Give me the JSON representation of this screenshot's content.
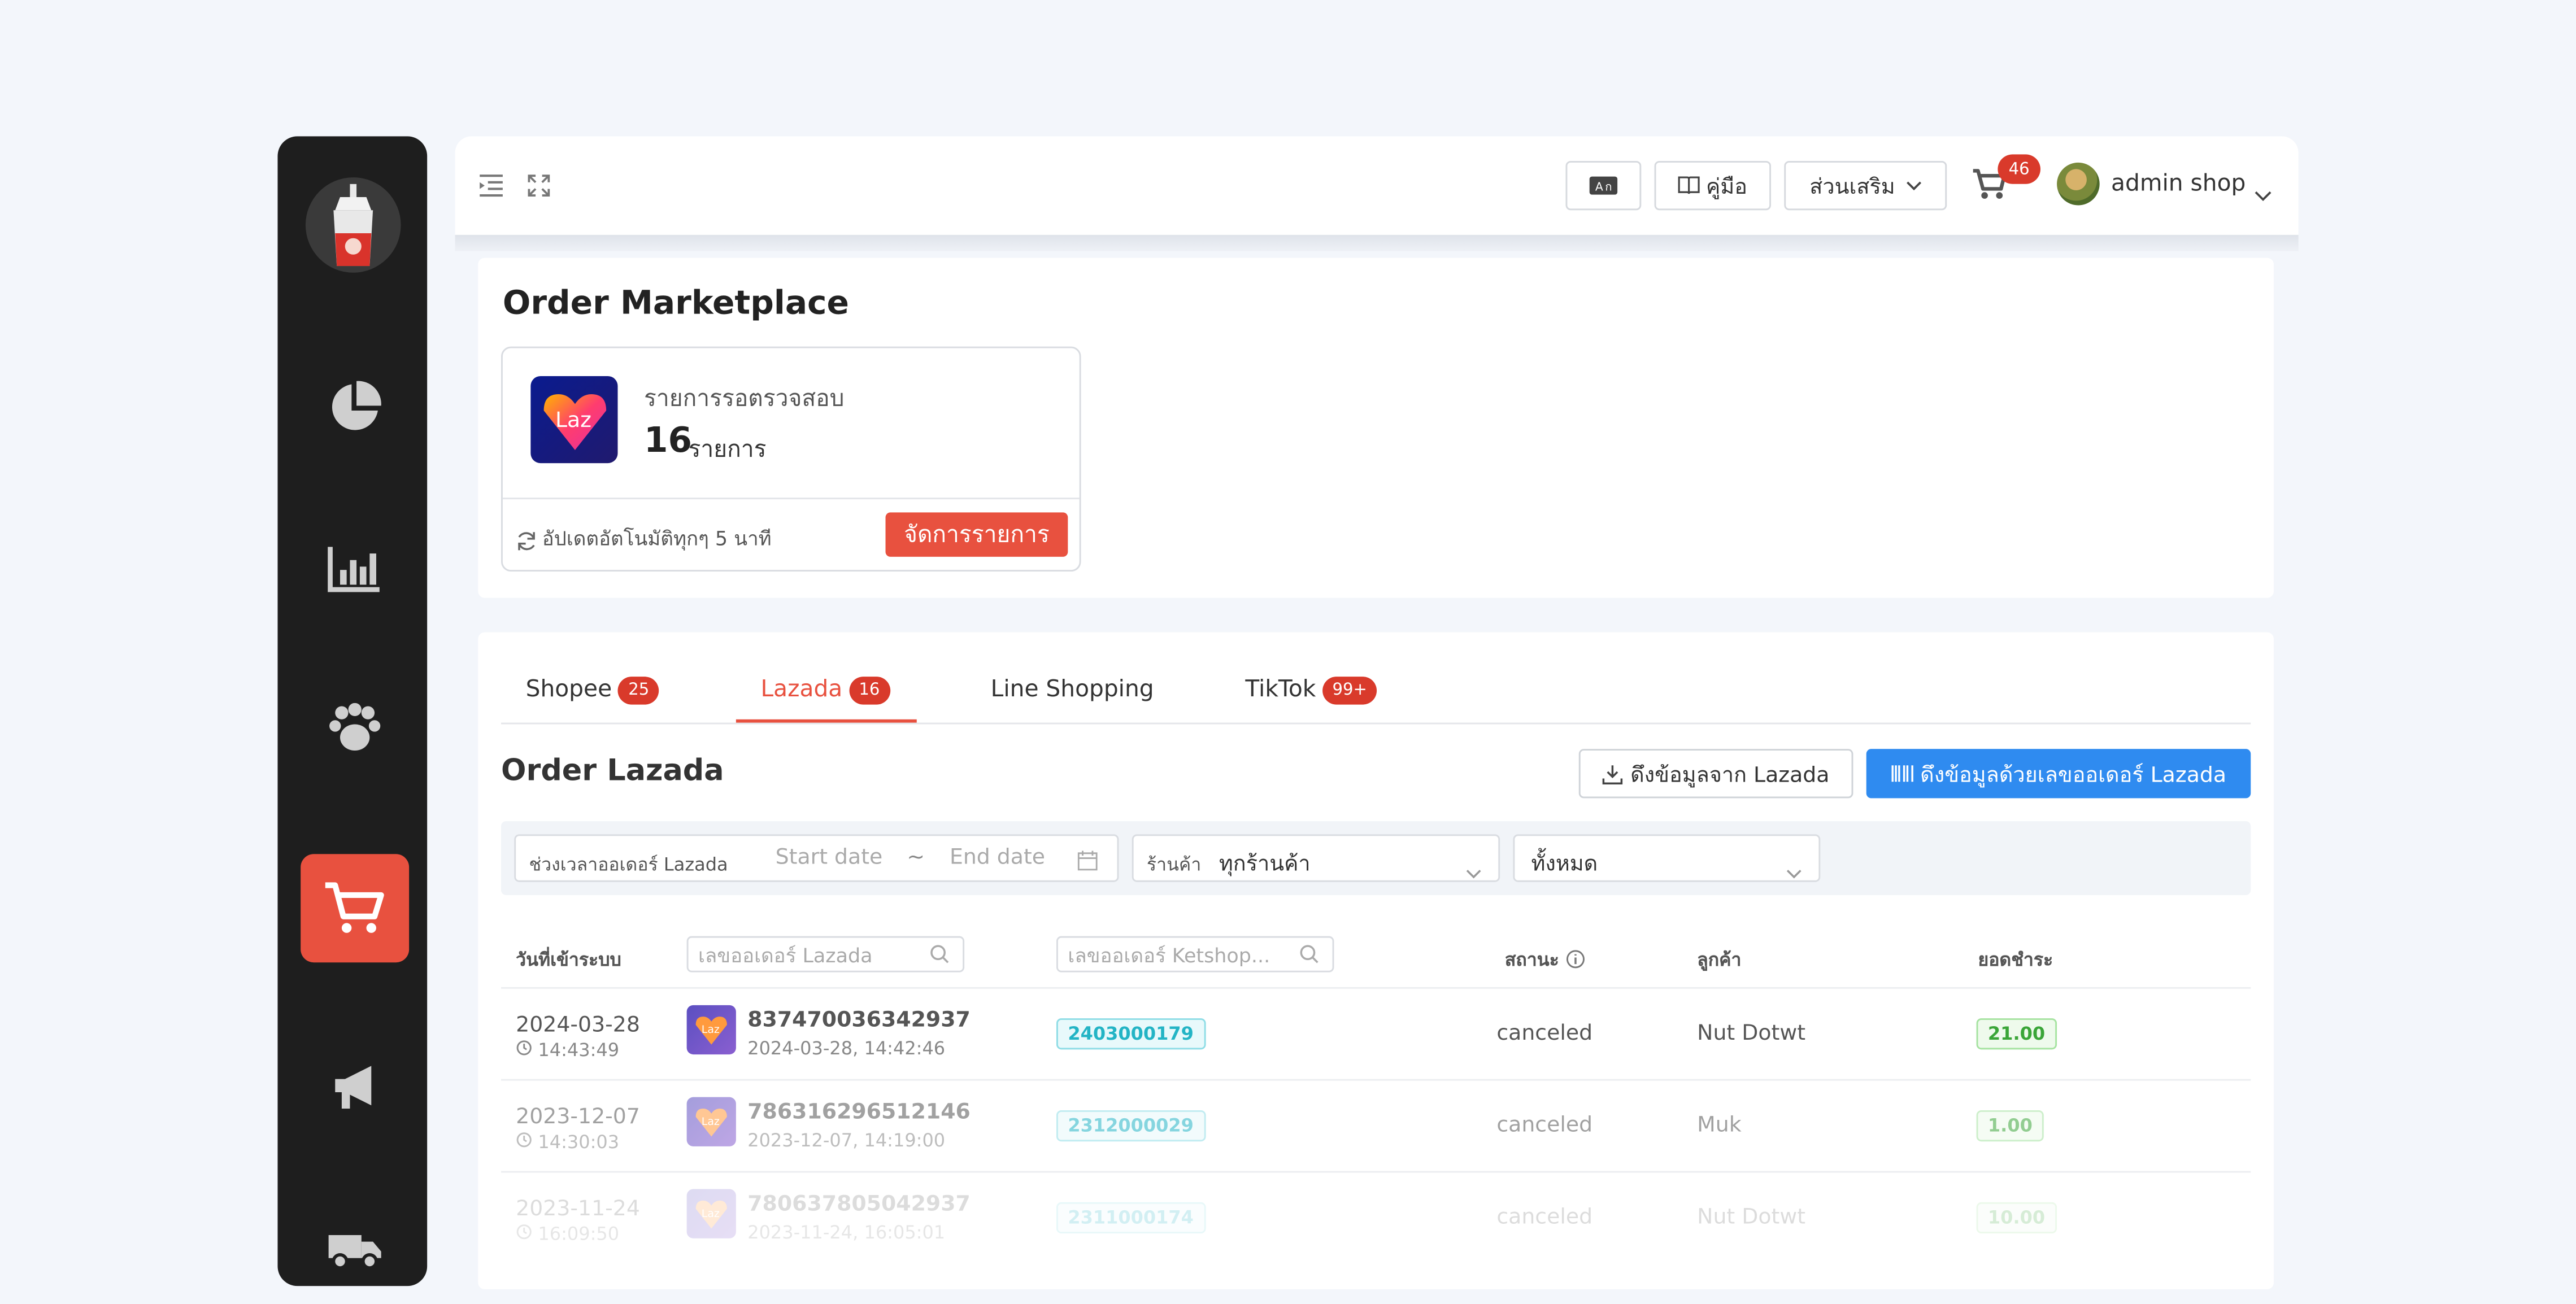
{
  "header": {
    "guide_label": "คู่มือ",
    "addons_label": "ส่วนเสริม",
    "cart_count": "46",
    "user_name": "admin shop"
  },
  "page": {
    "title": "Order Marketplace"
  },
  "lazada_card": {
    "pending_label": "รายการรอตรวจสอบ",
    "pending_count": "16",
    "pending_unit": "รายการ",
    "auto_update_text": "อัปเดตอัตโนมัติทุกๆ 5 นาที",
    "manage_label": "จัดการรายการ"
  },
  "tabs": [
    {
      "label": "Shopee",
      "badge": "25"
    },
    {
      "label": "Lazada",
      "badge": "16"
    },
    {
      "label": "Line Shopping",
      "badge": ""
    },
    {
      "label": "TikTok",
      "badge": "99+"
    }
  ],
  "section": {
    "title": "Order Lazada",
    "fetch_label": "ดึงข้อมูลจาก Lazada",
    "fetch_by_id_label": "ดึงข้อมูลด้วยเลขออเดอร์ Lazada"
  },
  "filters": {
    "date_range_label": "ช่วงเวลาออเดอร์ Lazada",
    "start_placeholder": "Start date",
    "separator": "~",
    "end_placeholder": "End date",
    "shop_label": "ร้านค้า",
    "shop_value": "ทุกร้านค้า",
    "status_value": "ทั้งหมด"
  },
  "table": {
    "col_date": "วันที่เข้าระบบ",
    "col_lazada_placeholder": "เลขออเดอร์ Lazada",
    "col_ketshop_placeholder": "เลขออเดอร์ Ketshop...",
    "col_status": "สถานะ",
    "col_customer": "ลูกค้า",
    "col_amount": "ยอดชำระ",
    "rows": [
      {
        "date": "2024-03-28",
        "time": "14:43:49",
        "order_no": "837470036342937",
        "order_dt": "2024-03-28, 14:42:46",
        "ketshop": "2403000179",
        "status": "canceled",
        "customer": "Nut Dotwt",
        "amount": "21.00"
      },
      {
        "date": "2023-12-07",
        "time": "14:30:03",
        "order_no": "786316296512146",
        "order_dt": "2023-12-07, 14:19:00",
        "ketshop": "2312000029",
        "status": "canceled",
        "customer": "Muk",
        "amount": "1.00"
      },
      {
        "date": "2023-11-24",
        "time": "16:09:50",
        "order_no": "780637805042937",
        "order_dt": "2023-11-24, 16:05:01",
        "ketshop": "2311000174",
        "status": "canceled",
        "customer": "Nut Dotwt",
        "amount": "10.00"
      }
    ]
  },
  "icons": {
    "sidebar": [
      "sauce-bottle-logo",
      "pie-chart-icon",
      "bar-chart-icon",
      "paw-icon",
      "cart-icon",
      "megaphone-icon",
      "truck-icon"
    ],
    "header": [
      "menu-fold-icon",
      "fullscreen-icon",
      "translate-icon",
      "book-icon",
      "chevron-down-icon",
      "cart-icon"
    ]
  },
  "colors": {
    "accent": "#e8513f",
    "primary": "#2f8bf0",
    "badge": "#d93a2b",
    "sidebar": "#1e1e1e"
  }
}
